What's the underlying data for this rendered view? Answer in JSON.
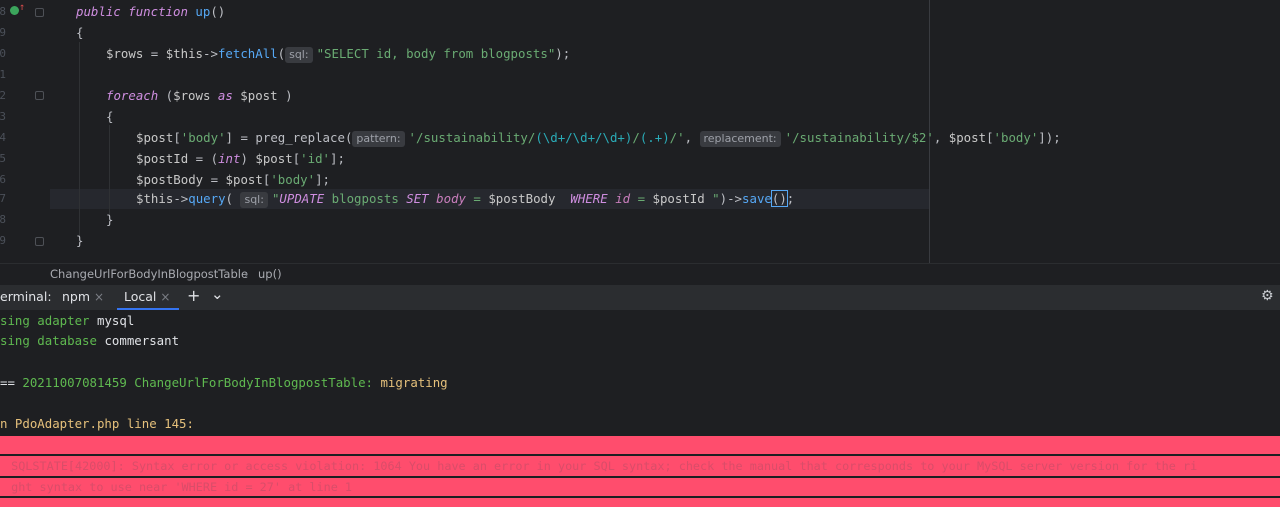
{
  "editor": {
    "line_numbers": [
      "8",
      "9",
      "0",
      "1",
      "2",
      "3",
      "4",
      "5",
      "6",
      "7",
      "8",
      "9"
    ],
    "code": {
      "l1": {
        "kw1": "public",
        "kw2": "function",
        "fn": "up",
        "rest": "()"
      },
      "l2": {
        "text": "{"
      },
      "l3": {
        "v": "$rows",
        "eq": " = ",
        "this": "$this",
        "arrow": "->",
        "fn": "fetchAll",
        "open": "(",
        "hint": "sql:",
        "str": "\"SELECT id, body from blogposts\"",
        "close": ");"
      },
      "l4": {
        "kw": "foreach",
        "open": " (",
        "v1": "$rows",
        "as": " as ",
        "v2": "$post",
        "close": " )"
      },
      "l5": {
        "text": "{"
      },
      "l6": {
        "v": "$post",
        "k_open": "[",
        "k": "'body'",
        "k_close": "]",
        "eq": " = ",
        "fn": "preg_replace",
        "open": "(",
        "hint1": "pattern:",
        "s1a": "'/sustainability/",
        "s1b": "(\\d+/\\d+/\\d+)",
        "s1c": "/",
        "s1d": "(.+)",
        "s1e": "/'",
        "comma1": ", ",
        "hint2": "replacement:",
        "s2": "'/sustainability/$2'",
        "comma2": ", ",
        "v2": "$post",
        "k2_open": "[",
        "k2": "'body'",
        "close": "]);"
      },
      "l7": {
        "v": "$postId",
        "eq": " = (",
        "cast": "int",
        "cast_close": ") ",
        "v2": "$post",
        "k_open": "[",
        "k": "'id'",
        "close": "];"
      },
      "l8": {
        "v": "$postBody",
        "eq": " = ",
        "v2": "$post",
        "k_open": "[",
        "k": "'body'",
        "close": "];"
      },
      "l9": {
        "this": "$this",
        "arrow": "->",
        "fn": "query",
        "open": "( ",
        "hint": "sql:",
        "q1": "\"",
        "q_update": "UPDATE",
        "q_tbl": " blogposts ",
        "q_set": "SET",
        "q_sp1": " ",
        "q_body": "body",
        "q_eq": " = ",
        "q_var1": "$postBody",
        "q_sp2": "  ",
        "q_where": "WHERE",
        "q_sp3": " ",
        "q_id": "id",
        "q_eq2": " = ",
        "q_var2": "$postId",
        "q_end": " \"",
        "close": ")->",
        "fn2": "save",
        "paren": "()",
        "semi": ";"
      },
      "l10": {
        "text": "}"
      },
      "l11": {
        "text": "}"
      }
    }
  },
  "breadcrumb": {
    "class_name": "ChangeUrlForBodyInBlogpostTable",
    "separator": "›",
    "method": "up()"
  },
  "terminal_header": {
    "title": "erminal:",
    "tabs": [
      {
        "label": "npm",
        "close": "×"
      },
      {
        "label": "Local",
        "close": "×"
      }
    ],
    "add": "+",
    "dropdown": "⌄",
    "settings": "⚙"
  },
  "terminal": {
    "lines": {
      "l1": {
        "a": "sing adapter ",
        "b": "mysql"
      },
      "l2": {
        "a": "sing database ",
        "b": "commersant"
      },
      "l3": {
        "a": "== ",
        "b": "20211007081459 ChangeUrlForBodyInBlogpostTable:",
        "c": " migrating"
      },
      "l4": {
        "a": "n PdoAdapter.php line 145:"
      }
    },
    "error1": " SQLSTATE[42000]: Syntax error or access violation: 1064 You have an error in your SQL syntax; check the manual that corresponds to your MySQL server version for the ri",
    "error2": " ght syntax to use near 'WHERE id = 27' at line 1"
  },
  "colors": {
    "editor_bg": "#1e1f22",
    "keyword": "#cf8ee0",
    "function": "#56a8f5",
    "string": "#6aab73",
    "error_bg": "#ff4d6d",
    "tab_underline": "#3574f0"
  }
}
